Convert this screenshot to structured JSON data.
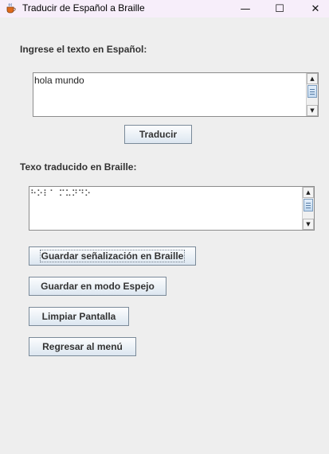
{
  "window": {
    "title": "Traducir de Español a Braille",
    "controls": {
      "minimize": "—",
      "maximize": "☐",
      "close": "✕"
    },
    "icons": {
      "app": "java-coffee-cup-icon"
    }
  },
  "input_section": {
    "label": "Ingrese el texto en Español:",
    "value": "hola mundo"
  },
  "translate_button": "Traducir",
  "output_section": {
    "label": "Texo traducido en Braille:",
    "value": "⠓⠕⠇⠁ ⠍⠥⠝⠙⠕"
  },
  "actions": {
    "save_signage": "Guardar señalización en Braille",
    "save_mirror": "Guardar en modo Espejo",
    "clear": "Limpiar Pantalla",
    "back": "Regresar al menú"
  },
  "colors": {
    "background": "#eeeeee",
    "titlebar": "#f7eefa",
    "button_border": "#7a8a99",
    "scroll_thumb": "#c3d9ef"
  }
}
